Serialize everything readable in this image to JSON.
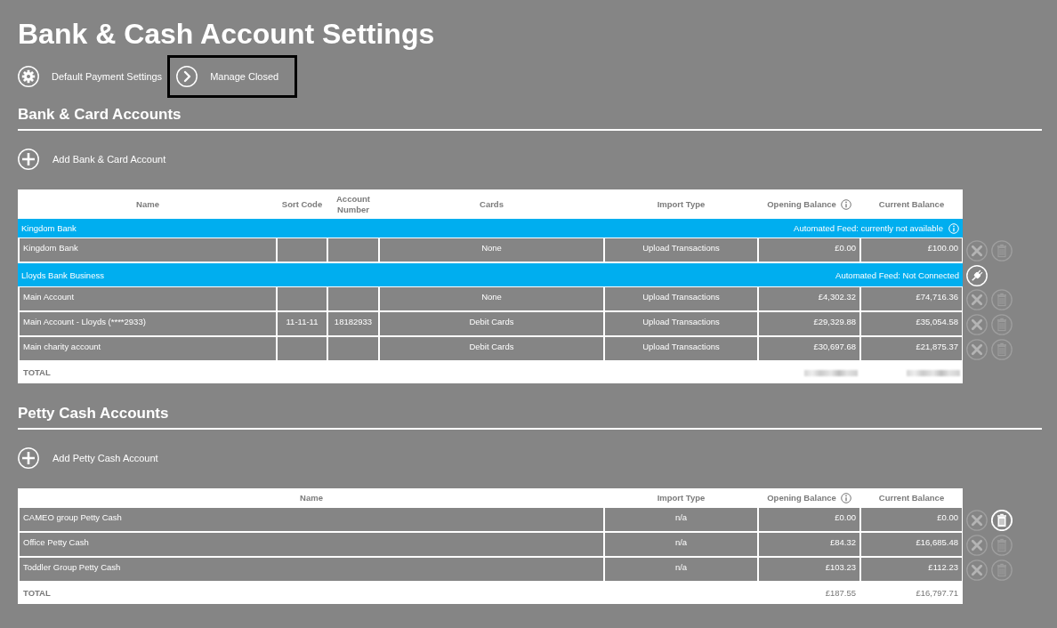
{
  "page": {
    "title": "Bank & Cash Account Settings"
  },
  "links": [
    {
      "kind": "settings",
      "label": "Default Payment Settings",
      "highlighted": false
    },
    {
      "kind": "next",
      "label": "Manage Closed",
      "highlighted": true
    }
  ],
  "bank_section": {
    "title": "Bank & Card Accounts",
    "add_label": "Add Bank & Card Account",
    "table": {
      "columns": [
        {
          "label": "Name",
          "info_icon": false
        },
        {
          "label": "Sort Code",
          "info_icon": false
        },
        {
          "label": "Account Number",
          "info_icon": false
        },
        {
          "label": "Cards",
          "info_icon": false
        },
        {
          "label": "Import Type",
          "info_icon": false
        },
        {
          "label": "Opening Balance",
          "info_icon": true
        },
        {
          "label": "Current Balance",
          "info_icon": false
        }
      ],
      "groups": [
        {
          "name": "Kingdom Bank",
          "feed_status": "Automated Feed: currently not available",
          "info_icon": true,
          "plug_button": false,
          "accounts": [
            {
              "name": "Kingdom Bank",
              "cards": "None",
              "import_type": "Upload Transactions",
              "opening_balance": "£0.00",
              "current_balance": "£100.00",
              "close_enabled": false,
              "delete_enabled": false
            }
          ]
        },
        {
          "name": "Lloyds Bank Business",
          "feed_status": "Automated Feed: Not Connected",
          "info_icon": false,
          "plug_button": true,
          "accounts": [
            {
              "name": "Main Account",
              "cards": "None",
              "import_type": "Upload Transactions",
              "opening_balance": "£4,302.32",
              "current_balance": "£74,716.36",
              "close_enabled": false,
              "delete_enabled": false
            },
            {
              "name": "Main Account - Lloyds (****2933)",
              "sort_code": "11-11-11",
              "account_number": "18182933",
              "cards": "Debit Cards",
              "import_type": "Upload Transactions",
              "opening_balance": "£29,329.88",
              "current_balance": "£35,054.58",
              "close_enabled": false,
              "delete_enabled": false
            },
            {
              "name": "Main charity account",
              "cards": "Debit Cards",
              "import_type": "Upload Transactions",
              "opening_balance": "£30,697.68",
              "current_balance": "£21,875.37",
              "close_enabled": false,
              "delete_enabled": false
            }
          ]
        }
      ],
      "total": {
        "label": "TOTAL",
        "blurred": true
      }
    }
  },
  "petty_section": {
    "title": "Petty Cash Accounts",
    "add_label": "Add Petty Cash Account",
    "table": {
      "columns": [
        {
          "label": "Name",
          "info_icon": false
        },
        {
          "label": "Import Type",
          "info_icon": false
        },
        {
          "label": "Opening Balance",
          "info_icon": true
        },
        {
          "label": "Current Balance",
          "info_icon": false
        }
      ],
      "rows": [
        {
          "name": "CAMEO group Petty Cash",
          "import_type": "n/a",
          "opening_balance": "£0.00",
          "current_balance": "£0.00",
          "close_enabled": false,
          "delete_enabled": true
        },
        {
          "name": "Office Petty Cash",
          "import_type": "n/a",
          "opening_balance": "£84.32",
          "current_balance": "£16,685.48",
          "close_enabled": false,
          "delete_enabled": false
        },
        {
          "name": "Toddler Group Petty Cash",
          "import_type": "n/a",
          "opening_balance": "£103.23",
          "current_balance": "£112.23",
          "close_enabled": false,
          "delete_enabled": false
        }
      ],
      "total": {
        "label": "TOTAL",
        "blurred": false,
        "opening_balance": "£187.55",
        "current_balance": "£16,797.71"
      }
    }
  }
}
